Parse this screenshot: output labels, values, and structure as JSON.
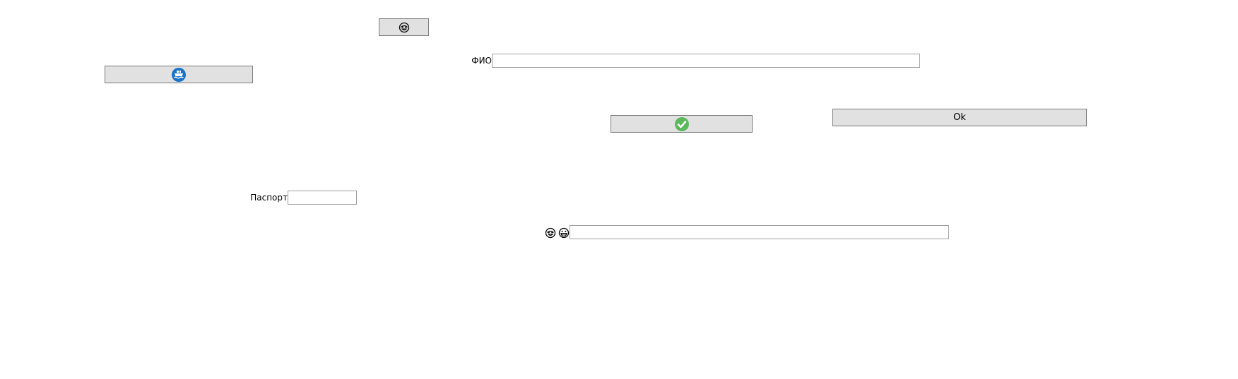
{
  "form": {
    "fio": {
      "label": "ФИО",
      "value": ""
    },
    "passport": {
      "label": "Паспорт",
      "value": ""
    },
    "emoji_row": {
      "value": ""
    },
    "ok_button": {
      "label": "Ok"
    }
  },
  "icons": {
    "face_button": "smiling-face-icon",
    "ship_button": "ship-icon",
    "confirm_button": "checkmark-icon",
    "emoji_row_left": "smiling-face-icon",
    "emoji_row_right": "grinning-face-icon"
  },
  "colors": {
    "button_bg": "#e1e1e1",
    "button_border": "#7a7a7a",
    "field_border": "#a0a0a0",
    "ship_blue": "#1a73c9",
    "check_green": "#5cb85c"
  }
}
